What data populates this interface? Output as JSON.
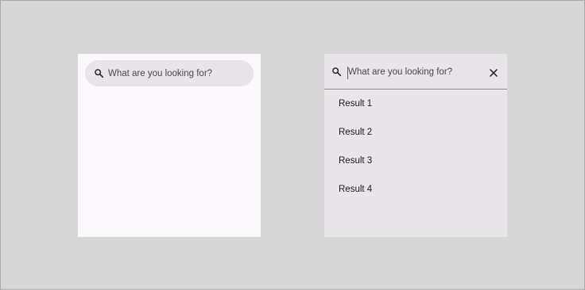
{
  "search_bar": {
    "icon": "search-icon",
    "placeholder": "What are you looking for?"
  },
  "search_view": {
    "icon": "search-icon",
    "placeholder": "What are you looking for?",
    "value": "",
    "close_icon": "close-icon",
    "results": [
      {
        "label": "Result 1"
      },
      {
        "label": "Result 2"
      },
      {
        "label": "Result 3"
      },
      {
        "label": "Result 4"
      }
    ]
  },
  "colors": {
    "background": "#d6d6d6",
    "surface": "#fcf7fd",
    "surface_container": "#e9e4ea",
    "on_surface": "#1c1b1f",
    "on_surface_variant": "#4a454f",
    "caret": "#6750a4"
  }
}
